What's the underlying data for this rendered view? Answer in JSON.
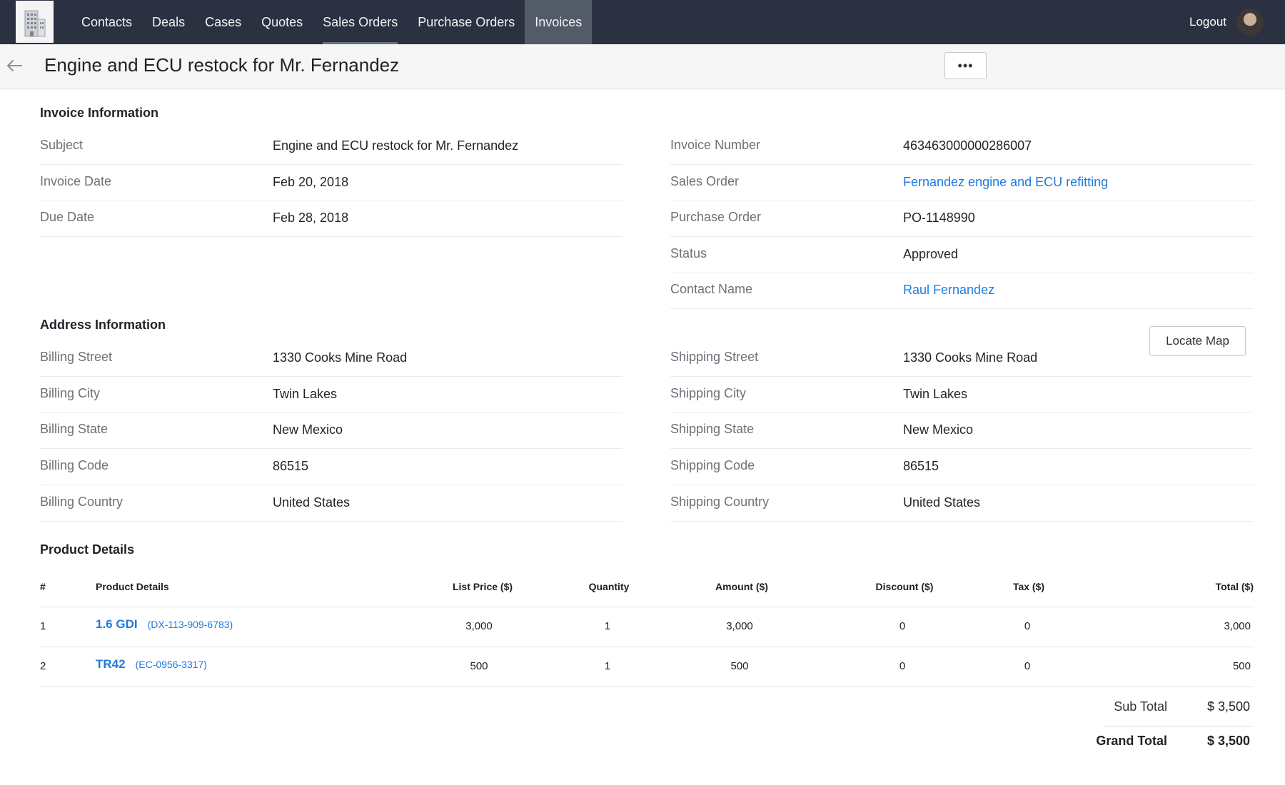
{
  "nav": {
    "items": [
      {
        "label": "Contacts"
      },
      {
        "label": "Deals"
      },
      {
        "label": "Cases"
      },
      {
        "label": "Quotes"
      },
      {
        "label": "Sales Orders"
      },
      {
        "label": "Purchase Orders"
      },
      {
        "label": "Invoices"
      }
    ],
    "active": "Invoices",
    "logout_label": "Logout"
  },
  "header": {
    "title": "Engine and ECU restock for Mr. Fernandez",
    "more_label": "•••"
  },
  "invoice_info": {
    "section_title": "Invoice Information",
    "left": [
      {
        "label": "Subject",
        "value": "Engine and ECU restock for Mr. Fernandez"
      },
      {
        "label": "Invoice Date",
        "value": "Feb 20, 2018"
      },
      {
        "label": "Due Date",
        "value": "Feb 28, 2018"
      }
    ],
    "right": [
      {
        "label": "Invoice Number",
        "value": "463463000000286007"
      },
      {
        "label": "Sales Order",
        "value": "Fernandez engine and ECU refitting"
      },
      {
        "label": "Purchase Order",
        "value": "PO-1148990"
      },
      {
        "label": "Status",
        "value": "Approved"
      },
      {
        "label": "Contact Name",
        "value": "Raul Fernandez"
      }
    ]
  },
  "address_info": {
    "section_title": "Address Information",
    "locate_map_label": "Locate Map",
    "left": [
      {
        "label": "Billing Street",
        "value": "1330 Cooks Mine Road"
      },
      {
        "label": "Billing City",
        "value": "Twin Lakes"
      },
      {
        "label": "Billing State",
        "value": "New Mexico"
      },
      {
        "label": "Billing Code",
        "value": "86515"
      },
      {
        "label": "Billing Country",
        "value": "United States"
      }
    ],
    "right": [
      {
        "label": "Shipping Street",
        "value": "1330 Cooks Mine Road"
      },
      {
        "label": "Shipping City",
        "value": "Twin Lakes"
      },
      {
        "label": "Shipping State",
        "value": "New Mexico"
      },
      {
        "label": "Shipping Code",
        "value": "86515"
      },
      {
        "label": "Shipping Country",
        "value": "United States"
      }
    ]
  },
  "products": {
    "section_title": "Product Details",
    "columns": [
      "#",
      "Product Details",
      "List Price ($)",
      "Quantity",
      "Amount ($)",
      "Discount ($)",
      "Tax ($)",
      "Total ($)"
    ],
    "rows": [
      {
        "num": "1",
        "name": "1.6 GDI",
        "code": "(DX-113-909-6783)",
        "list_price": "3,000",
        "quantity": "1",
        "amount": "3,000",
        "discount": "0",
        "tax": "0",
        "total": "3,000"
      },
      {
        "num": "2",
        "name": "TR42",
        "code": "(EC-0956-3317)",
        "list_price": "500",
        "quantity": "1",
        "amount": "500",
        "discount": "0",
        "tax": "0",
        "total": "500"
      }
    ]
  },
  "totals": {
    "sub_total_label": "Sub Total",
    "sub_total_value": "$ 3,500",
    "grand_total_label": "Grand Total",
    "grand_total_value": "$ 3,500"
  },
  "colors": {
    "nav_bg": "#2b3140",
    "nav_active": "#535a68",
    "link": "#1f7ae0"
  }
}
